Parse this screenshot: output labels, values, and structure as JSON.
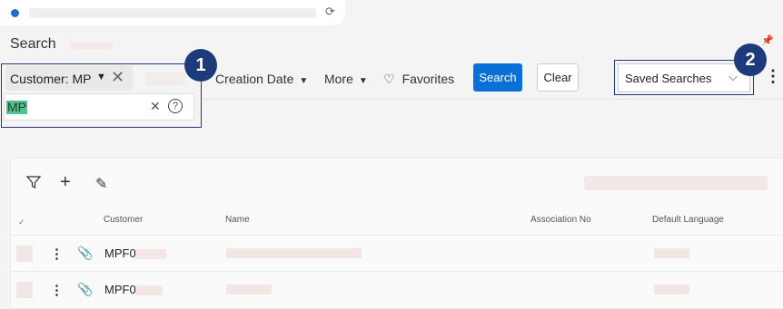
{
  "browser": {
    "icons": {
      "dot": "status-dot",
      "refresh": "refresh-icon"
    }
  },
  "page": {
    "title": "Search",
    "pin_icon": "pin-icon"
  },
  "filter": {
    "chip_label": "Customer: MP",
    "search_value": "MP",
    "callout_number": "1"
  },
  "toolbar": {
    "creation_date": "Creation Date",
    "more": "More",
    "favorites": "Favorites",
    "search_button": "Search",
    "clear_button": "Clear",
    "saved_searches": "Saved Searches",
    "callout_number": "2"
  },
  "table": {
    "columns": [
      "Customer",
      "Name",
      "Association No",
      "Default Language"
    ],
    "rows": [
      {
        "customer": "MPF0"
      },
      {
        "customer": "MPF0"
      }
    ]
  },
  "colors": {
    "primary": "#0a6fd6",
    "callout": "#1d3b7a",
    "highlight": "#4fc48c"
  }
}
